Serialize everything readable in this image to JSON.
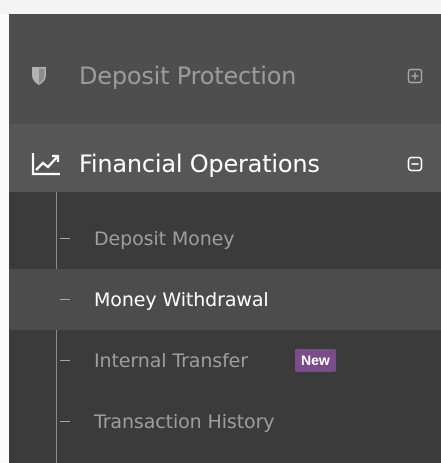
{
  "menu": {
    "deposit_protection": {
      "label": "Deposit Protection",
      "icon": "shield-icon",
      "toggle": "expand-plus-icon"
    },
    "financial_operations": {
      "label": "Financial Operations",
      "icon": "line-chart-icon",
      "toggle": "collapse-minus-icon",
      "items": [
        {
          "label": "Deposit Money"
        },
        {
          "label": "Money Withdrawal",
          "active": true
        },
        {
          "label": "Internal Transfer",
          "badge": "New"
        },
        {
          "label": "Transaction History"
        }
      ]
    }
  },
  "colors": {
    "sidebar_bg": "#4e4e4e",
    "submenu_bg": "#3b3b3b",
    "active_bg": "#4c4c4c",
    "badge_bg": "#7c4b8c",
    "text_active": "#ffffff",
    "text_muted": "#9e9e9e"
  }
}
